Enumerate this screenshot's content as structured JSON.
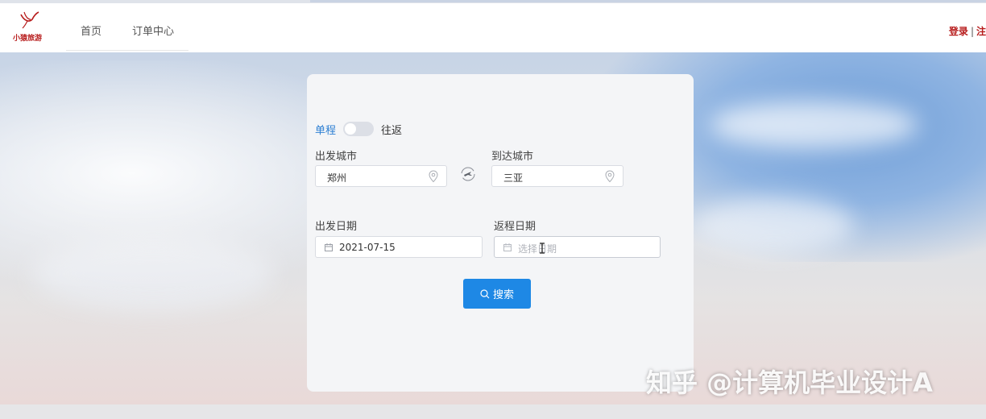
{
  "brand": {
    "logo_text": "小猿旅游"
  },
  "nav": {
    "home": "首页",
    "orders": "订单中心"
  },
  "auth": {
    "login": "登录",
    "separator": "|",
    "register": "注"
  },
  "form": {
    "trip_type": {
      "one_way": "单程",
      "round_trip": "往返",
      "toggle_on": false
    },
    "departure_city": {
      "label": "出发城市",
      "value": "郑州"
    },
    "arrival_city": {
      "label": "到达城市",
      "value": "三亚"
    },
    "departure_date": {
      "label": "出发日期",
      "value": "2021-07-15"
    },
    "return_date": {
      "label": "返程日期",
      "placeholder": "选择日期"
    },
    "search_button": "搜索"
  },
  "watermark": "知乎 @计算机毕业设计A",
  "colors": {
    "accent": "#1e88e5",
    "brand_red": "#b71c1c",
    "link_blue": "#2d7fd3"
  },
  "icons": {
    "pin": "location-pin-icon",
    "calendar": "calendar-icon",
    "swap": "plane-swap-icon",
    "search": "search-icon"
  }
}
